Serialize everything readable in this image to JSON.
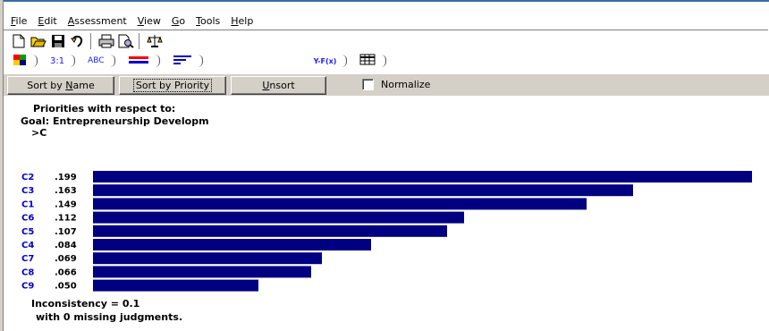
{
  "menu": [
    {
      "label": "File"
    },
    {
      "label": "Edit"
    },
    {
      "label": "Assessment"
    },
    {
      "label": "View"
    },
    {
      "label": "Go"
    },
    {
      "label": "Tools"
    },
    {
      "label": "Help"
    }
  ],
  "toolbar_icons": [
    "new-file-icon",
    "open-folder-icon",
    "save-icon",
    "undo-icon",
    "print-icon",
    "print-preview-icon",
    "scales-icon"
  ],
  "tabs": [
    {
      "label": "",
      "icon": "graph-colors-icon"
    },
    {
      "label": "3:1",
      "icon": ""
    },
    {
      "label": "ABC",
      "icon": ""
    },
    {
      "label": "",
      "icon": "red-blue-bars-icon"
    },
    {
      "label": "",
      "icon": "blue-lines-icon"
    },
    {
      "label": "Y-F(x)",
      "icon": ""
    },
    {
      "label": "",
      "icon": "grid-icon"
    }
  ],
  "commands": {
    "sort_by_name": "Sort by Name",
    "sort_by_priority": "Sort by Priority",
    "unsort": "Unsort",
    "normalize": "Normalize"
  },
  "content": {
    "heading1": "Priorities with respect to:",
    "heading2": "Goal: Entrepreneurship Developm",
    "heading3": ">C",
    "inconsistency": "Inconsistency = 0.1",
    "missing": "with 0  missing judgments."
  },
  "chart_data": {
    "type": "bar",
    "orientation": "horizontal",
    "categories": [
      "C2",
      "C3",
      "C1",
      "C6",
      "C5",
      "C4",
      "C7",
      "C8",
      "C9"
    ],
    "value_labels": [
      ".199",
      ".163",
      ".149",
      ".112",
      ".107",
      ".084",
      ".069",
      ".066",
      ".050"
    ],
    "values": [
      0.199,
      0.163,
      0.149,
      0.112,
      0.107,
      0.084,
      0.069,
      0.066,
      0.05
    ],
    "bar_color": "#000080",
    "label_color": "#0000cc"
  },
  "colors": {
    "chrome": "#d4d0c8",
    "title_accent": "#3a6ea5"
  }
}
